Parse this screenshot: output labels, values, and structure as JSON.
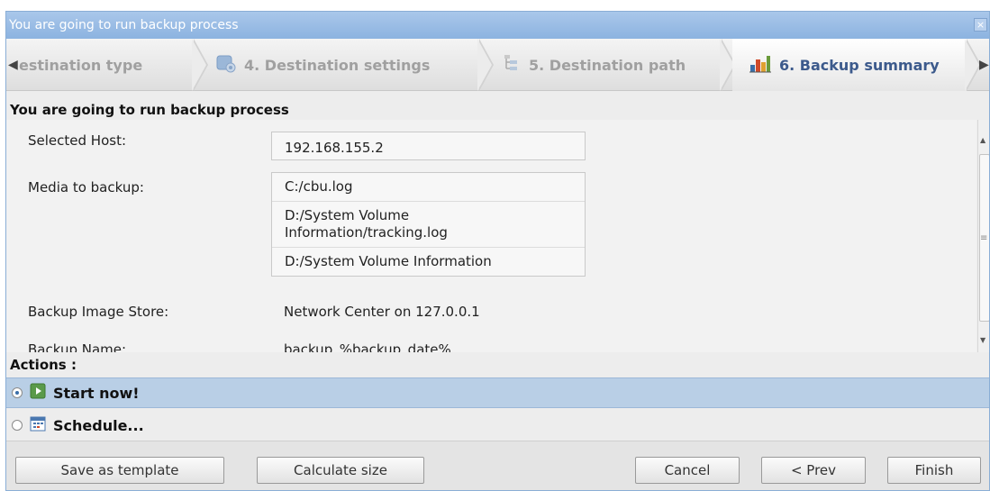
{
  "window": {
    "title": "You are going to run backup process",
    "close_glyph": "×"
  },
  "steps": [
    {
      "label": "Destination type",
      "visible_label": "estination type",
      "icon": "none",
      "active": false
    },
    {
      "label": "4. Destination settings",
      "icon": "settings-wizard-icon",
      "active": false
    },
    {
      "label": "5. Destination path",
      "icon": "path-icon",
      "active": false
    },
    {
      "label": "6. Backup summary",
      "icon": "bar-chart-icon",
      "active": true
    }
  ],
  "summary": {
    "title": "You are going to run backup process",
    "selected_host_label": "Selected Host:",
    "selected_host_value": "192.168.155.2",
    "media_label": "Media to backup:",
    "media_items": [
      "C:/cbu.log",
      "D:/System Volume Information/tracking.log",
      "D:/System Volume Information"
    ],
    "image_store_label": "Backup Image Store:",
    "image_store_value": "Network Center on 127.0.0.1",
    "backup_name_label": "Backup Name:",
    "backup_name_value": "backup_%backup_date%"
  },
  "actions": {
    "label": "Actions :",
    "options": [
      {
        "label": "Start now!",
        "icon": "start-icon",
        "selected": true
      },
      {
        "label": "Schedule...",
        "icon": "calendar-icon",
        "selected": false
      }
    ]
  },
  "buttons": {
    "save_template": "Save as template",
    "calculate_size": "Calculate size",
    "cancel": "Cancel",
    "prev": "< Prev",
    "finish": "Finish"
  },
  "colors": {
    "titlebar": "#8cb3e0",
    "selected_row": "#b9cfe6",
    "active_step_text": "#3c5a8c",
    "inactive_step_text": "#a0a0a0"
  }
}
